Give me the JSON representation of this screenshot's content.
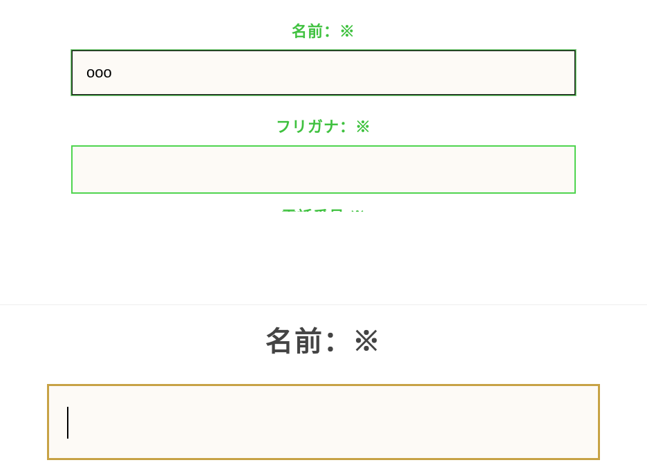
{
  "top_form": {
    "name_label": "名前：※",
    "name_value": "ooo",
    "furigana_label": "フリガナ：※",
    "furigana_value": "",
    "phone_label_partial": "電話番号 ※"
  },
  "bottom_form": {
    "name_label": "名前：※",
    "name_value": ""
  },
  "colors": {
    "accent_green": "#3fc13f",
    "accent_gold": "#c7a245",
    "text_dark": "#444444",
    "input_bg": "#fdfaf6"
  }
}
